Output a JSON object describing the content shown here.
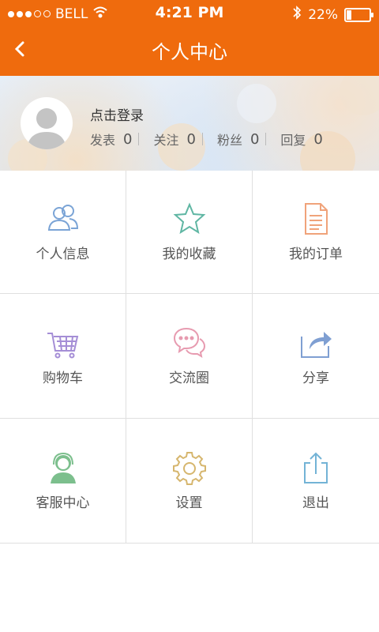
{
  "status_bar": {
    "carrier": "BELL",
    "time": "4:21 PM",
    "battery": "22%"
  },
  "header": {
    "title": "个人中心",
    "back_icon": "chevron-left-icon"
  },
  "profile": {
    "login_text": "点击登录",
    "stats": [
      {
        "label": "发表",
        "value": "0"
      },
      {
        "label": "关注",
        "value": "0"
      },
      {
        "label": "粉丝",
        "value": "0"
      },
      {
        "label": "回复",
        "value": "0"
      }
    ]
  },
  "menu": [
    {
      "label": "个人信息",
      "icon": "users-icon",
      "color": "#7ba4d6"
    },
    {
      "label": "我的收藏",
      "icon": "star-icon",
      "color": "#5fb6a3"
    },
    {
      "label": "我的订单",
      "icon": "document-icon",
      "color": "#f0a37a"
    },
    {
      "label": "购物车",
      "icon": "cart-icon",
      "color": "#a58ed6"
    },
    {
      "label": "交流圈",
      "icon": "chat-icon",
      "color": "#e79bb0"
    },
    {
      "label": "分享",
      "icon": "share-icon",
      "color": "#7f9fd2"
    },
    {
      "label": "客服中心",
      "icon": "support-agent-icon",
      "color": "#7cbf8d"
    },
    {
      "label": "设置",
      "icon": "gear-icon",
      "color": "#d6b66e"
    },
    {
      "label": "退出",
      "icon": "logout-icon",
      "color": "#73b3d6"
    }
  ],
  "colors": {
    "accent": "#ef6b0d"
  }
}
